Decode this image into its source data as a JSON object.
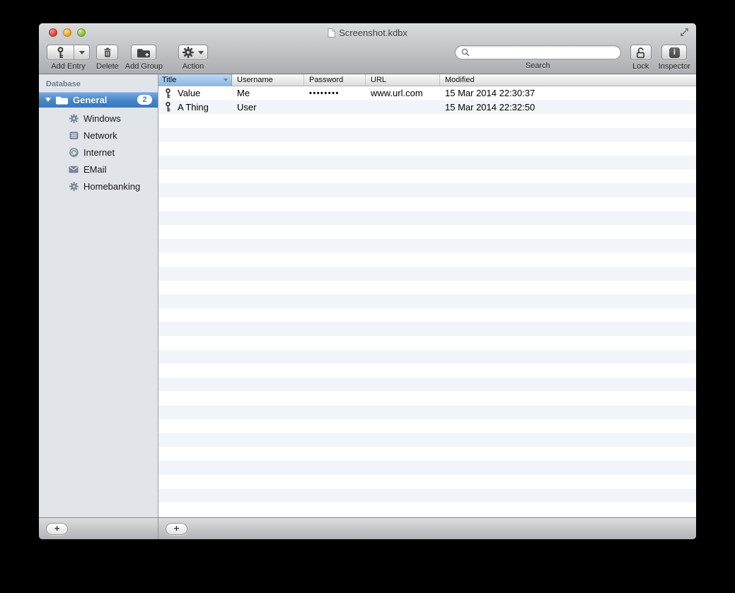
{
  "window": {
    "title": "Screenshot.kdbx"
  },
  "toolbar": {
    "add_entry_label": "Add Entry",
    "delete_label": "Delete",
    "add_group_label": "Add Group",
    "action_label": "Action",
    "search_label": "Search",
    "search_value": "",
    "lock_label": "Lock",
    "inspector_label": "Inspector"
  },
  "sidebar": {
    "header": "Database",
    "group": {
      "label": "General",
      "badge": "2",
      "icon": "folder-icon"
    },
    "items": [
      {
        "label": "Windows",
        "icon": "gear-icon"
      },
      {
        "label": "Network",
        "icon": "server-icon"
      },
      {
        "label": "Internet",
        "icon": "globe-icon"
      },
      {
        "label": "EMail",
        "icon": "envelope-icon"
      },
      {
        "label": "Homebanking",
        "icon": "gear-icon"
      }
    ],
    "add_button_label": "+"
  },
  "table": {
    "columns": [
      "Title",
      "Username",
      "Password",
      "URL",
      "Modified"
    ],
    "rows": [
      {
        "title": "Value",
        "username": "Me",
        "password": "••••••••",
        "url": "www.url.com",
        "modified": "15 Mar 2014 22:30:37"
      },
      {
        "title": "A Thing",
        "username": "User",
        "password": "",
        "url": "",
        "modified": "15 Mar 2014 22:32:50"
      }
    ],
    "add_button_label": "+"
  },
  "colors": {
    "selection_blue": "#3a77bf",
    "header_highlight_blue": "#8bb8e4",
    "row_stripe": "#f1f5f9",
    "sidebar_bg": "#e1e5ea"
  }
}
